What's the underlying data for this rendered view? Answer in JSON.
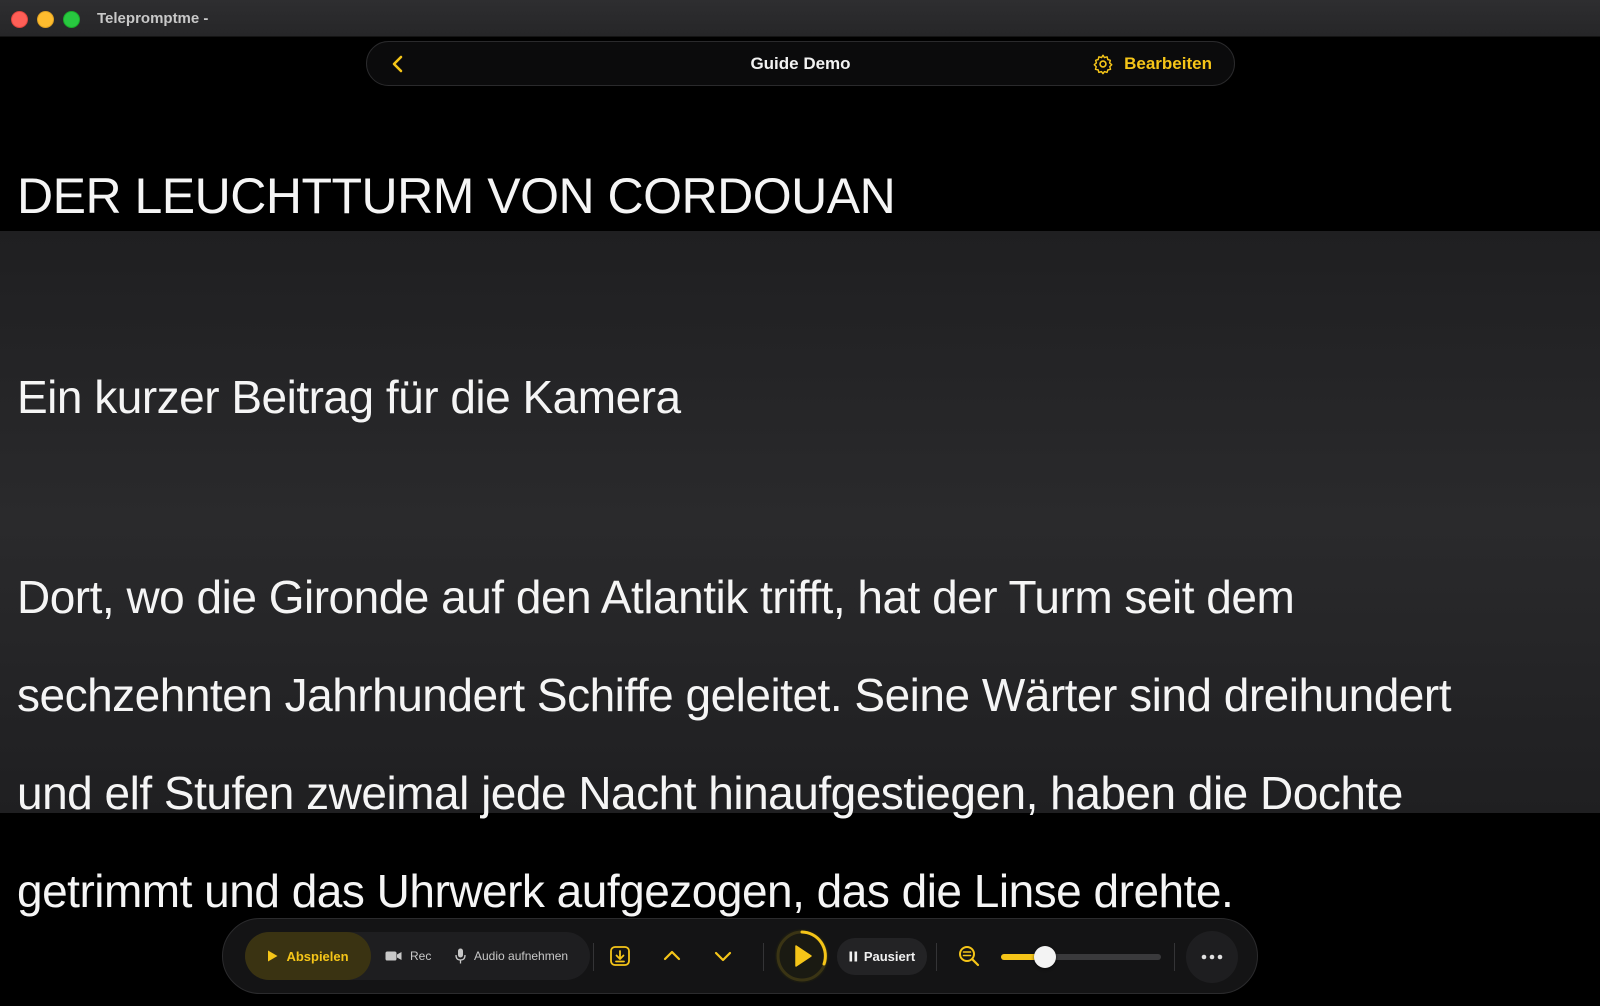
{
  "window": {
    "title": "Telepromptme -"
  },
  "nav": {
    "back_icon": "chevron-left-icon",
    "title": "Guide Demo",
    "edit_icon": "gear-icon",
    "edit_label": "Bearbeiten"
  },
  "script": {
    "heading": "DER LEUCHTTURM VON CORDOUAN",
    "subheading": "Ein kurzer Beitrag für die Kamera",
    "paragraph_lines": [
      "Dort, wo die Gironde auf den Atlantik trifft, hat der Turm seit dem",
      "sechzehnten Jahrhundert Schiffe geleitet. Seine Wärter sind dreihundert",
      "und elf Stufen zweimal jede Nacht hinaufgestiegen, haben die Dochte",
      "getrimmt und das Uhrwerk aufgezogen, das die Linse drehte."
    ]
  },
  "controls": {
    "play_label": "Abspielen",
    "rec_label": "Rec",
    "audio_label": "Audio aufnehmen",
    "status_label": "Pausiert",
    "zoom_level": 0.24,
    "icons": [
      "play-icon",
      "video-camera-icon",
      "microphone-icon",
      "import-icon",
      "chevron-up-icon",
      "chevron-down-icon",
      "pause-icon",
      "zoom-out-icon",
      "more-icon"
    ]
  },
  "colors": {
    "accent": "#f5c518",
    "background": "#000000",
    "reading_band": "#2a2a2c",
    "text": "#f5f5f5"
  }
}
